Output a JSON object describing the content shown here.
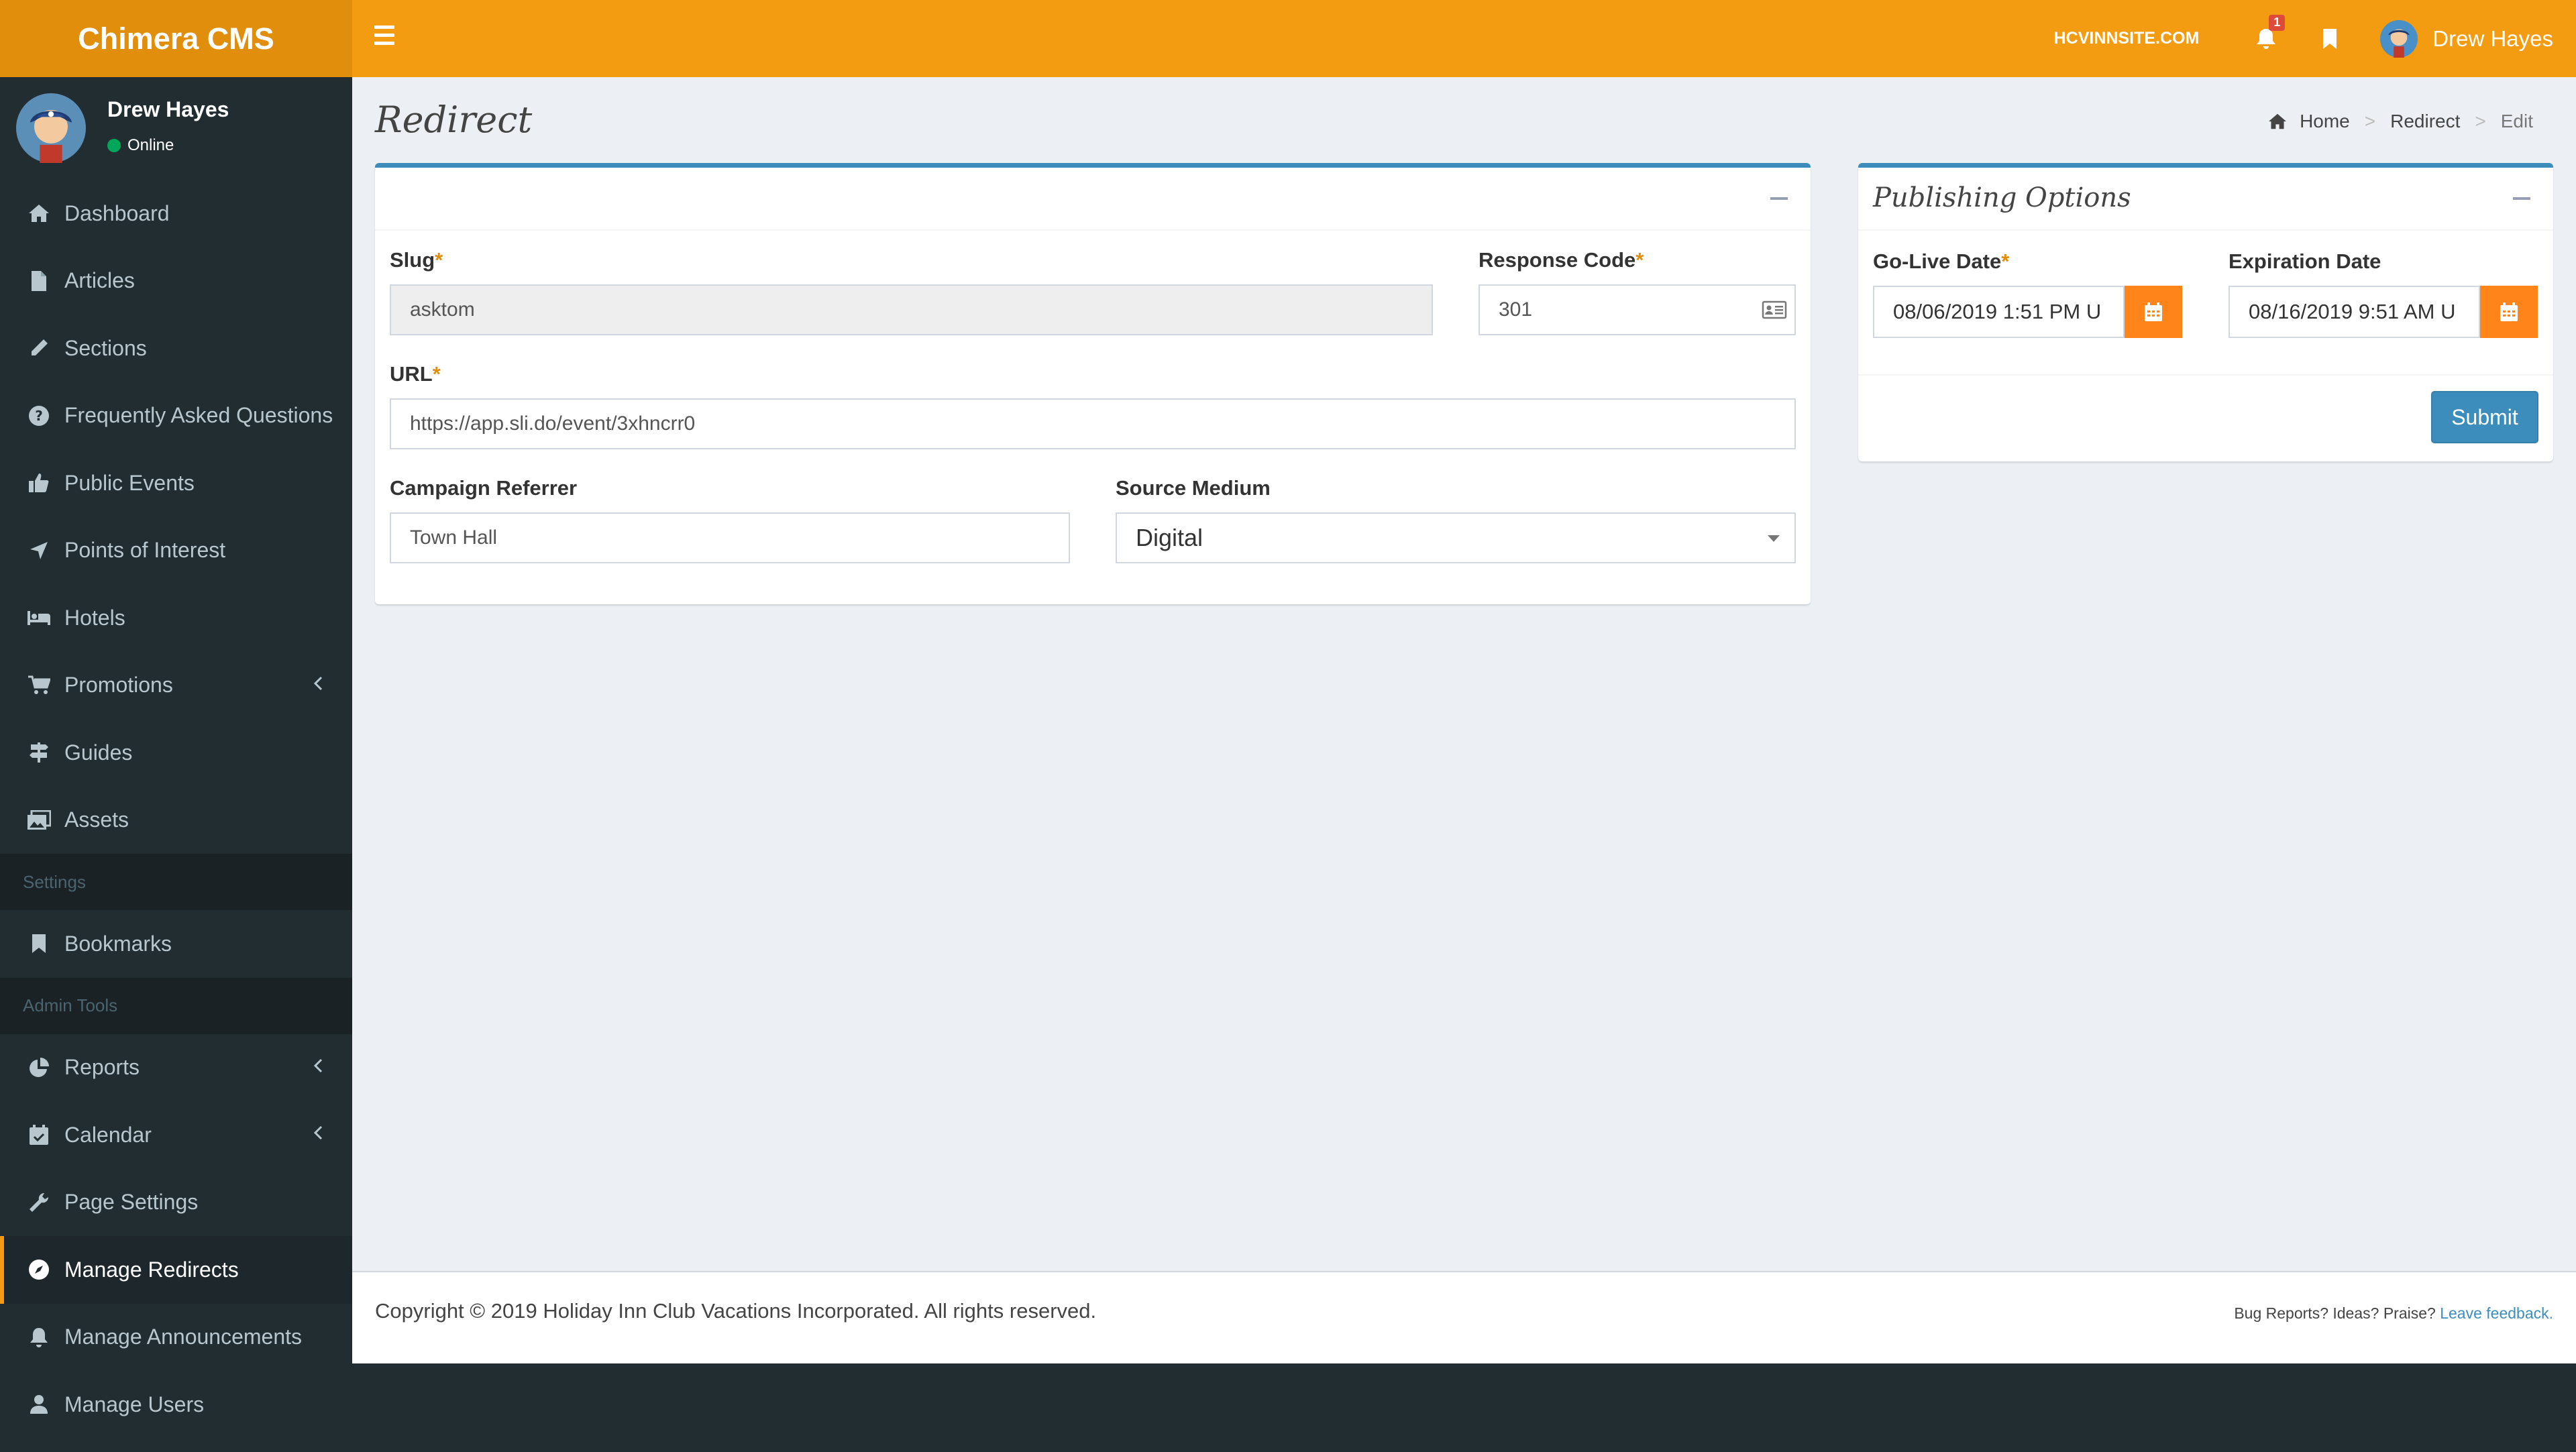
{
  "app": {
    "brand": "Chimera CMS"
  },
  "header": {
    "site": "HCVINNSITE.COM",
    "notification_count": "1",
    "user_name": "Drew Hayes"
  },
  "sidebar": {
    "user": {
      "name": "Drew Hayes",
      "status": "Online"
    },
    "items": [
      {
        "label": "Dashboard",
        "icon": "home-icon"
      },
      {
        "label": "Articles",
        "icon": "file-icon"
      },
      {
        "label": "Sections",
        "icon": "pencil-icon"
      },
      {
        "label": "Frequently Asked Questions",
        "icon": "question-icon"
      },
      {
        "label": "Public Events",
        "icon": "thumbs-up-icon"
      },
      {
        "label": "Points of Interest",
        "icon": "location-arrow-icon"
      },
      {
        "label": "Hotels",
        "icon": "bed-icon"
      },
      {
        "label": "Promotions",
        "icon": "cart-icon"
      },
      {
        "label": "Guides",
        "icon": "signpost-icon"
      },
      {
        "label": "Assets",
        "icon": "images-icon"
      }
    ],
    "settings_header": "Settings",
    "settings_items": [
      {
        "label": "Bookmarks",
        "icon": "bookmark-icon"
      }
    ],
    "admin_header": "Admin Tools",
    "admin_items": [
      {
        "label": "Reports",
        "icon": "pie-chart-icon"
      },
      {
        "label": "Calendar",
        "icon": "calendar-check-icon"
      },
      {
        "label": "Page Settings",
        "icon": "wrench-icon"
      },
      {
        "label": "Manage Redirects",
        "icon": "compass-icon"
      },
      {
        "label": "Manage Announcements",
        "icon": "bell-icon"
      },
      {
        "label": "Manage Users",
        "icon": "user-icon"
      }
    ]
  },
  "page": {
    "title": "Redirect",
    "breadcrumb": [
      "Home",
      "Redirect",
      "Edit"
    ]
  },
  "form": {
    "slug_label": "Slug",
    "slug_value": "asktom",
    "response_code_label": "Response Code",
    "response_code_value": "301",
    "url_label": "URL",
    "url_value": "https://app.sli.do/event/3xhncrr0",
    "campaign_label": "Campaign Referrer",
    "campaign_value": "Town Hall",
    "source_label": "Source Medium",
    "source_value": "Digital",
    "required_mark": "*"
  },
  "publishing": {
    "title": "Publishing Options",
    "golive_label": "Go-Live Date",
    "golive_value": "08/06/2019 1:51 PM U",
    "expiration_label": "Expiration Date",
    "expiration_value": "08/16/2019 9:51 AM U",
    "submit_label": "Submit"
  },
  "footer": {
    "copyright": "Copyright © 2019 Holiday Inn Club Vacations Incorporated. All rights reserved.",
    "feedback_prefix": "Bug Reports? Ideas? Praise?",
    "feedback_link": "Leave feedback."
  },
  "colors": {
    "header": "#f39c12",
    "logo_bg": "#e08e0b",
    "sidebar": "#222d32",
    "primary": "#3c8dbc",
    "calendar_button": "#ff851b"
  }
}
